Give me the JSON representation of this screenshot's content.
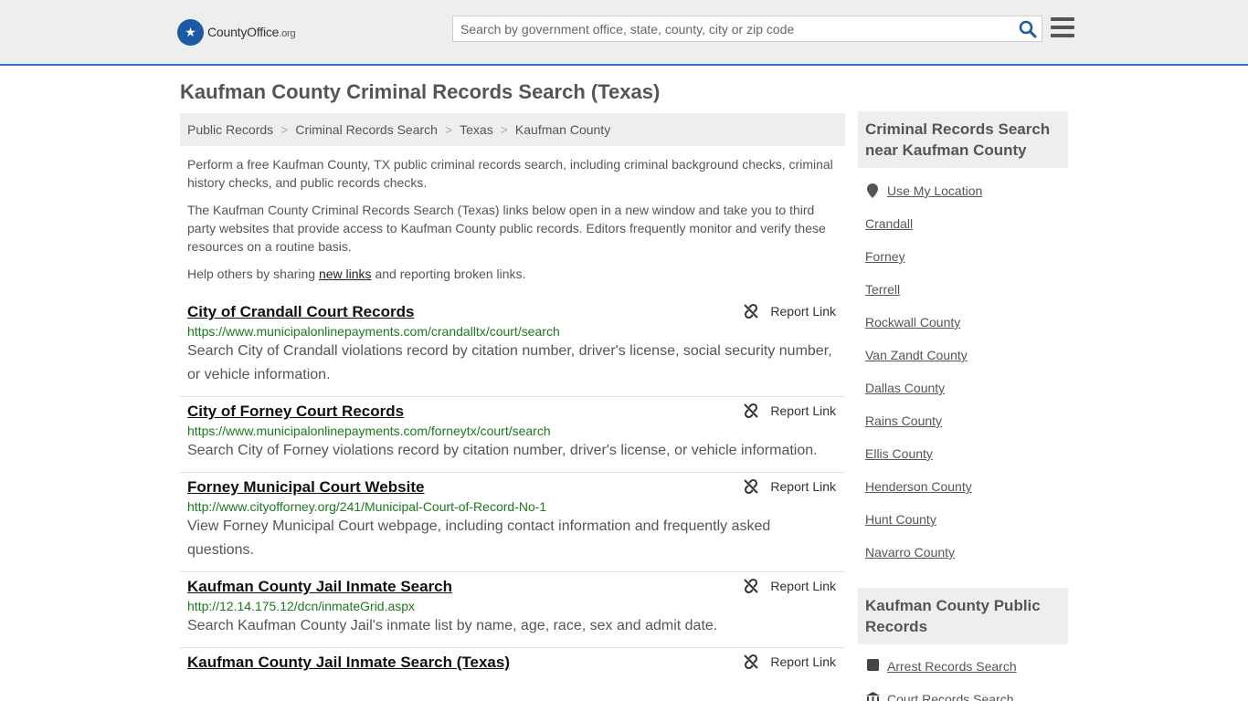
{
  "header": {
    "logo_text": "CountyOffice",
    "logo_suffix": ".org",
    "search_placeholder": "Search by government office, state, county, city or zip code"
  },
  "page_title": "Kaufman County Criminal Records Search (Texas)",
  "breadcrumb": [
    "Public Records",
    "Criminal Records Search",
    "Texas",
    "Kaufman County"
  ],
  "intro": {
    "p1": "Perform a free Kaufman County, TX public criminal records search, including criminal background checks, criminal history checks, and public records checks.",
    "p2": "The Kaufman County Criminal Records Search (Texas) links below open in a new window and take you to third party websites that provide access to Kaufman County public records. Editors frequently monitor and verify these resources on a routine basis.",
    "p3_before": "Help others by sharing ",
    "p3_link": "new links",
    "p3_after": " and reporting broken links."
  },
  "report_label": "Report Link",
  "records": [
    {
      "title": "City of Crandall Court Records",
      "url": "https://www.municipalonlinepayments.com/crandalltx/court/search",
      "desc": "Search City of Crandall violations record by citation number, driver's license, social security number, or vehicle information."
    },
    {
      "title": "City of Forney Court Records",
      "url": "https://www.municipalonlinepayments.com/forneytx/court/search",
      "desc": "Search City of Forney violations record by citation number, driver's license, or vehicle information."
    },
    {
      "title": "Forney Municipal Court Website",
      "url": "http://www.cityofforney.org/241/Municipal-Court-of-Record-No-1",
      "desc": "View Forney Municipal Court webpage, including contact information and frequently asked questions."
    },
    {
      "title": "Kaufman County Jail Inmate Search",
      "url": "http://12.14.175.12/dcn/inmateGrid.aspx",
      "desc": "Search Kaufman County Jail's inmate list by name, age, race, sex and admit date."
    },
    {
      "title": "Kaufman County Jail Inmate Search (Texas)",
      "url": "",
      "desc": ""
    }
  ],
  "sidebar": {
    "nearby_heading": "Criminal Records Search near Kaufman County",
    "use_location": "Use My Location",
    "nearby": [
      "Crandall",
      "Forney",
      "Terrell",
      "Rockwall County",
      "Van Zandt County",
      "Dallas County",
      "Rains County",
      "Ellis County",
      "Henderson County",
      "Hunt County",
      "Navarro County"
    ],
    "public_heading": "Kaufman County Public Records",
    "public_links": [
      "Arrest Records Search",
      "Court Records Search"
    ]
  }
}
